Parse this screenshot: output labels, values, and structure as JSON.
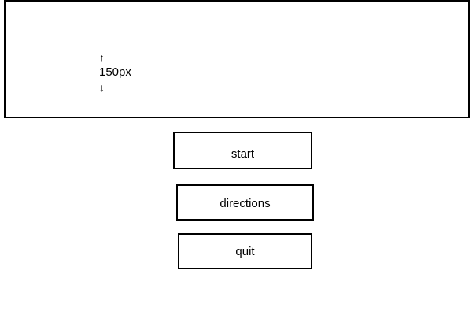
{
  "header": {
    "dimension": {
      "arrow_up": "↑",
      "label": "150px",
      "arrow_down": "↓"
    }
  },
  "menu": {
    "start_label": "start",
    "directions_label": "directions",
    "quit_label": "quit"
  }
}
